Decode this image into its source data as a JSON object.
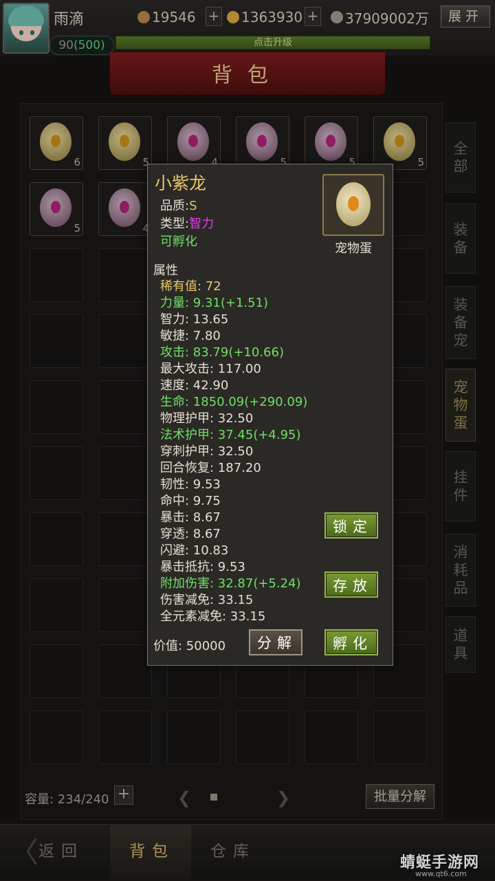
{
  "player": {
    "name": "雨滴",
    "level": "90",
    "level_cap": "(500)",
    "exp_hint": "点击升级"
  },
  "resources": [
    {
      "value": "19546",
      "color": "#b8864a"
    },
    {
      "value": "1363930",
      "color": "#d8a640"
    },
    {
      "value": "37909002万",
      "color": "#a09a8a"
    }
  ],
  "header": {
    "expand_label": "展开",
    "title": "背包"
  },
  "bag": {
    "items": [
      {
        "egg": "gold",
        "count": "6"
      },
      {
        "egg": "gold",
        "count": "5"
      },
      {
        "egg": "purple",
        "count": "4"
      },
      {
        "egg": "purple",
        "count": "5"
      },
      {
        "egg": "purple",
        "count": "5"
      },
      {
        "egg": "gold",
        "count": "5"
      },
      {
        "egg": "purple",
        "count": "5"
      },
      {
        "egg": "purple",
        "count": "4"
      }
    ],
    "capacity": "容量: 234/240",
    "batch_label": "批量分解"
  },
  "side_tabs": [
    "全部",
    "装备",
    "装备宠",
    "宠物蛋",
    "挂件",
    "消耗品",
    "道具"
  ],
  "active_side_tab": 3,
  "bottom_nav": {
    "back": "返回",
    "bag": "背包",
    "warehouse": "仓库"
  },
  "watermark": {
    "text": "蜻蜓手游网",
    "sub": "www.qt6.com"
  },
  "popup": {
    "name": "小紫龙",
    "quality_label": "品质:",
    "quality_value": "S",
    "type_label": "类型:",
    "type_value": "智力",
    "hatchable": "可孵化",
    "item_kind": "宠物蛋",
    "section_title": "属性",
    "stats": [
      {
        "text": "稀有值: 72",
        "tone": "gold"
      },
      {
        "text": "力量: 9.31(+1.51)",
        "tone": "green"
      },
      {
        "text": "智力: 13.65",
        "tone": "white"
      },
      {
        "text": "敏捷: 7.80",
        "tone": "white"
      },
      {
        "text": "攻击: 83.79(+10.66)",
        "tone": "green"
      },
      {
        "text": "最大攻击: 117.00",
        "tone": "white"
      },
      {
        "text": "速度: 42.90",
        "tone": "white"
      },
      {
        "text": "生命: 1850.09(+290.09)",
        "tone": "green"
      },
      {
        "text": "物理护甲: 32.50",
        "tone": "white"
      },
      {
        "text": "法术护甲: 37.45(+4.95)",
        "tone": "green"
      },
      {
        "text": "穿刺护甲: 32.50",
        "tone": "white"
      },
      {
        "text": "回合恢复: 187.20",
        "tone": "white"
      },
      {
        "text": "韧性: 9.53",
        "tone": "white"
      },
      {
        "text": "命中: 9.75",
        "tone": "white"
      },
      {
        "text": "暴击: 8.67",
        "tone": "white"
      },
      {
        "text": "穿透: 8.67",
        "tone": "white"
      },
      {
        "text": "闪避: 10.83",
        "tone": "white"
      },
      {
        "text": "暴击抵抗: 9.53",
        "tone": "white"
      },
      {
        "text": "附加伤害: 32.87(+5.24)",
        "tone": "green"
      },
      {
        "text": "伤害减免: 33.15",
        "tone": "white"
      },
      {
        "text": "全元素减免: 33.15",
        "tone": "white"
      }
    ],
    "value_text": "价值: 50000",
    "buttons": {
      "lock": "锁定",
      "store": "存放",
      "decompose": "分解",
      "hatch": "孵化"
    }
  }
}
